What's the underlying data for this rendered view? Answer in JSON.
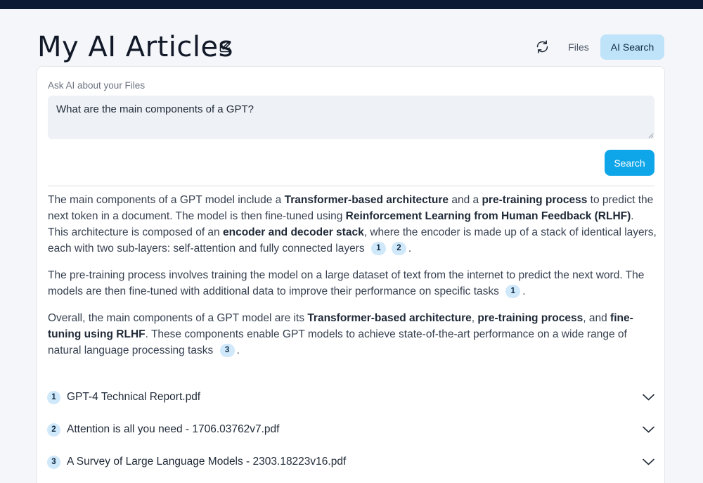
{
  "header": {
    "title": "My AI Articles",
    "files_label": "Files",
    "ai_search_label": "AI Search"
  },
  "search": {
    "label": "Ask AI about your Files",
    "query": "What are the main components of a GPT?",
    "button_label": "Search"
  },
  "answer": {
    "p1": [
      {
        "t": "The main components of a GPT model include a "
      },
      {
        "t": "Transformer-based architecture",
        "b": true
      },
      {
        "t": " and a "
      },
      {
        "t": "pre-training process",
        "b": true
      },
      {
        "t": " to predict the next token in a document. The model is then fine-tuned using "
      },
      {
        "t": "Reinforcement Learning from Human Feedback (RLHF)",
        "b": true
      },
      {
        "t": ". This architecture is composed of an "
      },
      {
        "t": "encoder and decoder stack",
        "b": true
      },
      {
        "t": ", where the encoder is made up of a stack of identical layers, each with two sub-layers: self-attention and fully connected layers "
      },
      {
        "c": "1"
      },
      {
        "c": "2"
      },
      {
        "t": "."
      }
    ],
    "p2": [
      {
        "t": "The pre-training process involves training the model on a large dataset of text from the internet to predict the next word. The models are then fine-tuned with additional data to improve their performance on specific tasks "
      },
      {
        "c": "1"
      },
      {
        "t": "."
      }
    ],
    "p3": [
      {
        "t": "Overall, the main components of a GPT model are its "
      },
      {
        "t": "Transformer-based architecture",
        "b": true
      },
      {
        "t": ", "
      },
      {
        "t": "pre-training process",
        "b": true
      },
      {
        "t": ", and "
      },
      {
        "t": "fine-tuning using RLHF",
        "b": true
      },
      {
        "t": ". These components enable GPT models to achieve state-of-the-art performance on a wide range of natural language processing tasks "
      },
      {
        "c": "3"
      },
      {
        "t": "."
      }
    ]
  },
  "sources": [
    {
      "num": "1",
      "name": "GPT-4 Technical Report.pdf"
    },
    {
      "num": "2",
      "name": "Attention is all you need - 1706.03762v7.pdf"
    },
    {
      "num": "3",
      "name": "A Survey of Large Language Models - 2303.18223v16.pdf"
    }
  ],
  "icons": {
    "edit": "edit-icon",
    "refresh": "refresh-icon",
    "expand": "chevron-down-icon"
  },
  "colors": {
    "topbar": "#0c1a33",
    "accent": "#0ea5e9",
    "active_tab": "#bfe3f9",
    "citation_badge": "#cfe8fa"
  }
}
